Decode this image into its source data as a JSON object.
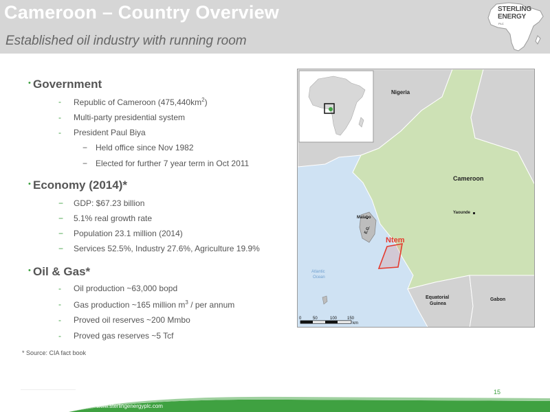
{
  "header": {
    "title": "Cameroon – Country Overview",
    "subtitle": "Established oil industry with running room",
    "logo_line1": "STERLING",
    "logo_line2": "ENERGY",
    "logo_plc": "PLC"
  },
  "colors": {
    "accent": "#3fa141",
    "header_bg": "#d6d6d6",
    "land": "#cde1b5",
    "sea": "#cfe2f3"
  },
  "sections": {
    "government": {
      "heading": "Government",
      "items": {
        "i0_pre": "Republic of Cameroon (475,440km",
        "i0_sup": "2",
        "i0_post": ")",
        "i1": "Multi-party presidential system",
        "i2": "President Paul Biya",
        "s0": "Held office since Nov 1982",
        "s1": "Elected for further 7 year term in Oct 2011"
      }
    },
    "economy": {
      "heading": "Economy (2014)*",
      "items": {
        "i0": "GDP: $67.23 billion",
        "i1": "5.1% real growth rate",
        "i2": "Population 23.1 million (2014)",
        "i3": "Services 52.5%, Industry 27.6%, Agriculture 19.9%"
      }
    },
    "oil": {
      "heading": "Oil & Gas*",
      "items": {
        "i0": "Oil production ~63,000 bopd",
        "i1_pre": "Gas production ~165 million m",
        "i1_sup": "3",
        "i1_post": " / per annum",
        "i2": "Proved oil reserves ~200 Mmbo",
        "i3": "Proved gas reserves ~5 Tcf"
      }
    }
  },
  "source": "* Source: CIA fact book",
  "map": {
    "nigeria": "Nigeria",
    "cameroon": "Cameroon",
    "yaounde": "Yaounde",
    "malabo": "Malabo",
    "eg": "E.G.",
    "ntem": "Ntem",
    "atlantic1": "Atlantic",
    "atlantic2": "Ocean",
    "eqg1": "Equatorial",
    "eqg2": "Guinea",
    "gabon": "Gabon",
    "scale": [
      "0",
      "50",
      "100",
      "150"
    ],
    "scale_unit": "km"
  },
  "footer": {
    "url": "www.sterlingenergyplc.com",
    "page": "15"
  }
}
